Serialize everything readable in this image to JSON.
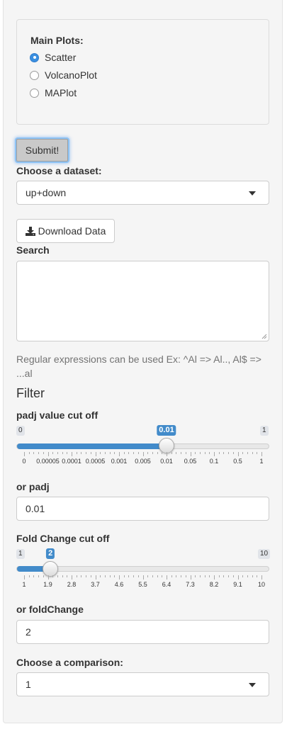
{
  "main_plots": {
    "label": "Main Plots:",
    "options": [
      {
        "label": "Scatter",
        "checked": true
      },
      {
        "label": "VolcanoPlot",
        "checked": false
      },
      {
        "label": "MAPlot",
        "checked": false
      }
    ]
  },
  "submit_label": "Submit!",
  "dataset": {
    "label": "Choose a dataset:",
    "value": "up+down"
  },
  "download_label": "Download Data",
  "search": {
    "label": "Search",
    "value": "",
    "help": "Regular expressions can be used Ex: ^Al => Al.., Al$ => ...al"
  },
  "filter_heading": "Filter",
  "padj_slider": {
    "label": "padj value cut off",
    "min_label": "0",
    "max_label": "1",
    "value_label": "0.01",
    "position_fraction": 0.6,
    "ticks": [
      "0",
      "0.00005",
      "0.0001",
      "0.0005",
      "0.001",
      "0.005",
      "0.01",
      "0.05",
      "0.1",
      "0.5",
      "1"
    ]
  },
  "or_padj": {
    "label": "or padj",
    "value": "0.01"
  },
  "fc_slider": {
    "label": "Fold Change cut off",
    "min_label": "1",
    "max_label": "10",
    "value": 2,
    "min": 1,
    "max": 10,
    "ticks": [
      "1",
      "1.9",
      "2.8",
      "3.7",
      "4.6",
      "5.5",
      "6.4",
      "7.3",
      "8.2",
      "9.1",
      "10"
    ]
  },
  "or_foldchange": {
    "label": "or foldChange",
    "value": "2"
  },
  "comparison": {
    "label": "Choose a comparison:",
    "value": "1"
  },
  "colors": {
    "accent": "#428bca",
    "panel": "#f5f5f5"
  }
}
